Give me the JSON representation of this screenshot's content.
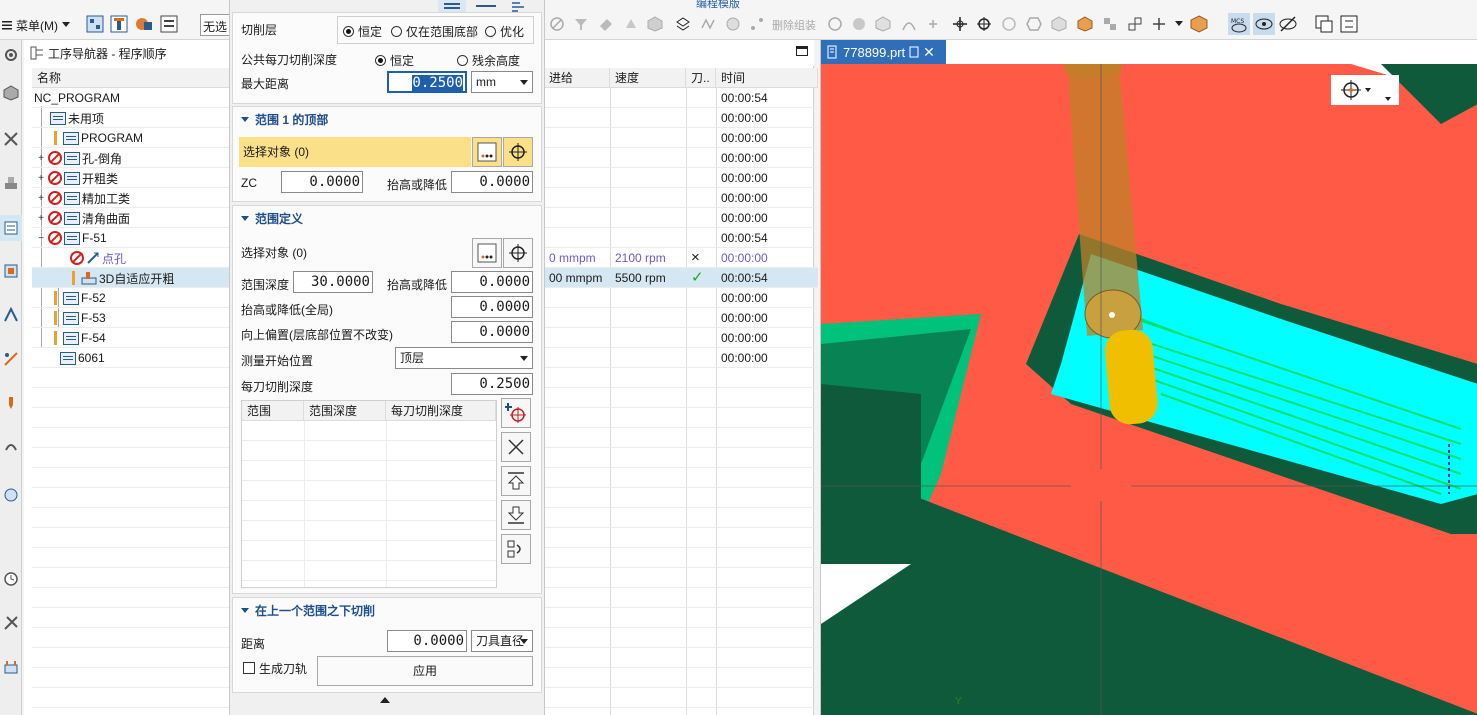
{
  "toolbar": {
    "menu_label": "菜单(M)",
    "filter_value": "无选",
    "tab_label": "编程模版",
    "delete_group_label": "删除组装",
    "icons": [
      "hamburger-icon",
      "program-order-view-icon",
      "machine-tool-view-icon",
      "geometry-view-icon",
      "method-view-icon",
      "select-all-icon",
      "filter-icon",
      "cube-icon",
      "eraser-icon",
      "face-icon",
      "layer-icon",
      "curve-icon",
      "point-icon",
      "snap-icon",
      "csys-icon",
      "mcs-icon",
      "tool-path-icon",
      "verify-icon",
      "display-icon",
      "settings-icon"
    ]
  },
  "left_bar": {
    "icons": [
      "settings-icon",
      "part-icon",
      "assembly-icon",
      "constraint-icon",
      "operation-navigator-icon",
      "machine-tool-icon",
      "ops-icon",
      "feature-icon",
      "drill-icon",
      "sensor-icon",
      "history-icon",
      "clock-icon",
      "tool-icon",
      "wrench-icon"
    ]
  },
  "navigator": {
    "title": "工序导航器 - 程序顺序",
    "columns": {
      "name": "名称",
      "feed": "进给",
      "speed": "速度",
      "tool": "刀..",
      "time": "时间"
    },
    "rows": [
      {
        "name": "NC_PROGRAM",
        "feed": "",
        "speed": "",
        "tool": "",
        "time": "00:00:54"
      },
      {
        "name": "未用项",
        "feed": "",
        "speed": "",
        "tool": "",
        "time": "00:00:00"
      },
      {
        "name": "PROGRAM",
        "feed": "",
        "speed": "",
        "tool": "",
        "time": "00:00:00"
      },
      {
        "name": "孔-倒角",
        "feed": "",
        "speed": "",
        "tool": "",
        "time": "00:00:00"
      },
      {
        "name": "开粗类",
        "feed": "",
        "speed": "",
        "tool": "",
        "time": "00:00:00"
      },
      {
        "name": "精加工类",
        "feed": "",
        "speed": "",
        "tool": "",
        "time": "00:00:00"
      },
      {
        "name": "清角曲面",
        "feed": "",
        "speed": "",
        "tool": "",
        "time": "00:00:00"
      },
      {
        "name": "F-51",
        "feed": "",
        "speed": "",
        "tool": "",
        "time": "00:00:54"
      },
      {
        "name": "点孔",
        "feed": "0 mmpm",
        "speed": "2100 rpm",
        "tool": "×",
        "time": "00:00:00"
      },
      {
        "name": "3D自适应开粗",
        "feed": "00 mmpm",
        "speed": "5500 rpm",
        "tool": "✓",
        "time": "00:00:54"
      },
      {
        "name": "F-52",
        "feed": "",
        "speed": "",
        "tool": "",
        "time": "00:00:00"
      },
      {
        "name": "F-53",
        "feed": "",
        "speed": "",
        "tool": "",
        "time": "00:00:00"
      },
      {
        "name": "F-54",
        "feed": "",
        "speed": "",
        "tool": "",
        "time": "00:00:00"
      },
      {
        "name": "6061",
        "feed": "",
        "speed": "",
        "tool": "",
        "time": "00:00:00"
      }
    ]
  },
  "dialog": {
    "cut_levels": {
      "label": "切削层",
      "options": [
        "恒定",
        "仅在范围底部",
        "优化"
      ],
      "selected": "恒定"
    },
    "common_depth": {
      "label": "公共每刀切削深度",
      "options": [
        "恒定",
        "残余高度"
      ],
      "selected": "恒定"
    },
    "max_distance": {
      "label": "最大距离",
      "value": "0.2500",
      "unit": "mm"
    },
    "top_of_range": {
      "title": "范围 1 的顶部",
      "select_label": "选择对象 (0)",
      "zc_label": "ZC",
      "zc_value": "0.0000",
      "raise_lower_label": "抬高或降低",
      "raise_lower_value": "0.0000"
    },
    "range_definition": {
      "title": "范围定义",
      "select_label": "选择对象 (0)",
      "range_depth_label": "范围深度",
      "range_depth_value": "30.0000",
      "raise_lower_label": "抬高或降低",
      "raise_lower_value": "0.0000",
      "global_raise_label": "抬高或降低(全局)",
      "global_raise_value": "0.0000",
      "offset_up_label": "向上偏置(层底部位置不改变)",
      "offset_up_value": "0.0000",
      "measure_from_label": "测量开始位置",
      "measure_from_value": "顶层",
      "depth_per_cut_label": "每刀切削深度",
      "depth_per_cut_value": "0.2500",
      "table_columns": [
        "范围",
        "范围深度",
        "每刀切削深度"
      ]
    },
    "below_last_range": {
      "title": "在上一个范围之下切削",
      "distance_label": "距离",
      "distance_value": "0.0000",
      "distance_unit": "刀具直径",
      "generate_label": "生成刀轨",
      "apply_label": "应用"
    }
  },
  "viewport": {
    "tab_label": "778899.prt",
    "axis_label": "Y",
    "colors": {
      "part_top": "#ff5a46",
      "part_side": "#0e5a3a",
      "stock": "#00c27a",
      "toolpath": "#00e070",
      "pocket_floor": "#00ffff",
      "tool": "#f0c000"
    }
  }
}
